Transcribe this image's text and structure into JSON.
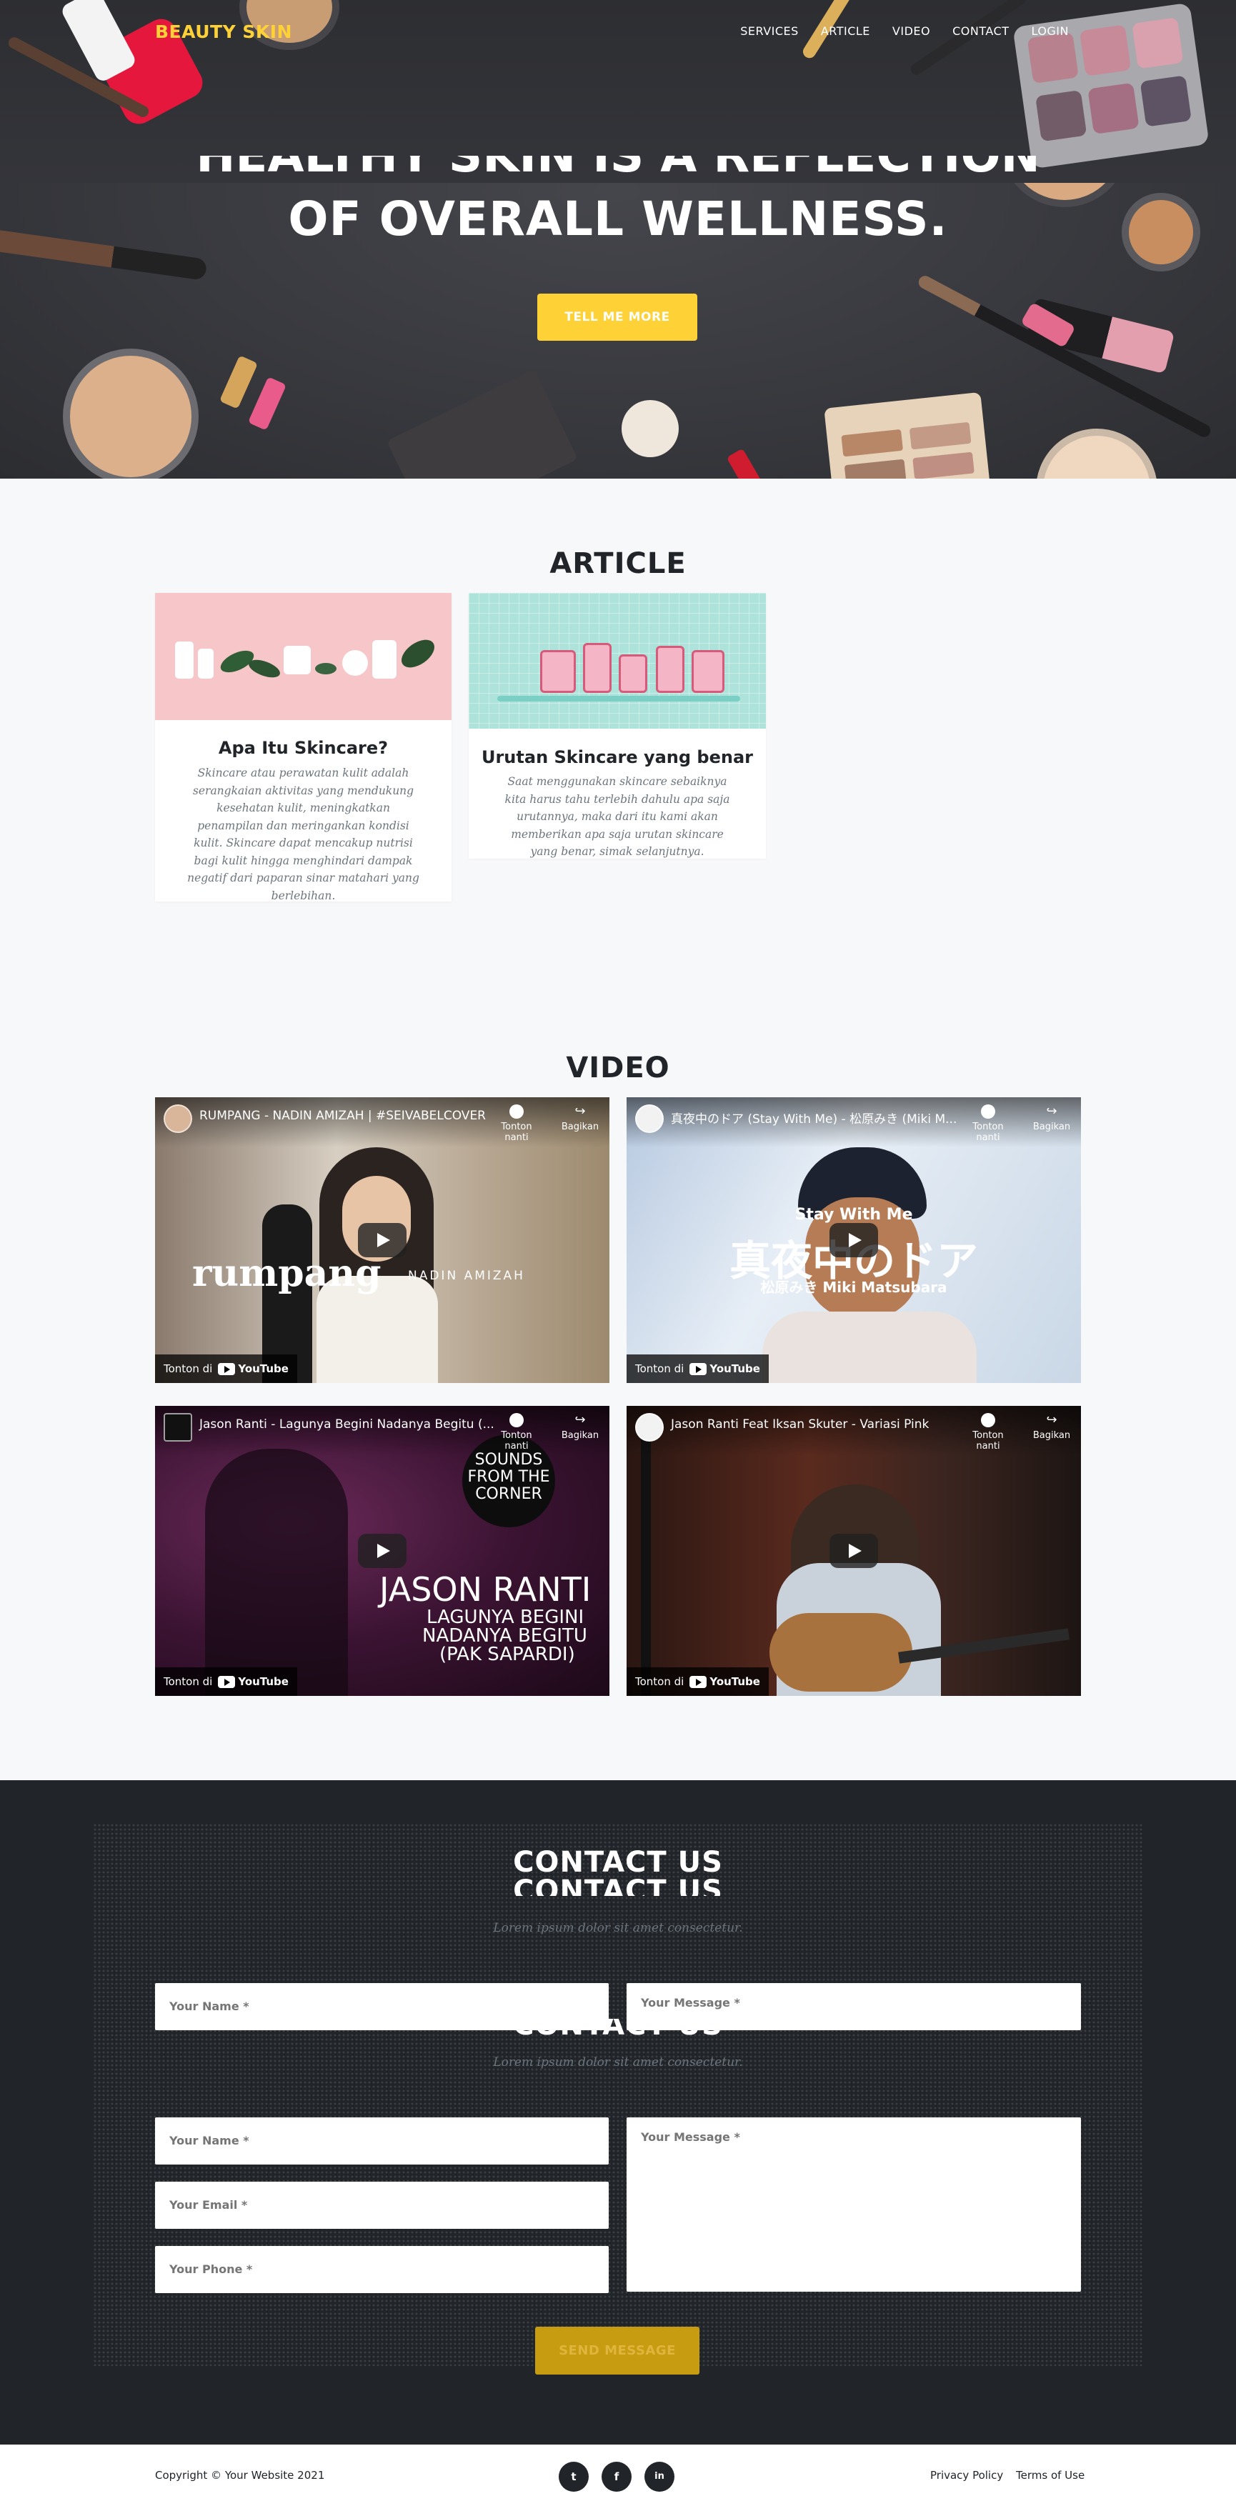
{
  "nav": {
    "brand": "BEAUTY SKIN",
    "links": [
      "SERVICES",
      "ARTICLE",
      "VIDEO",
      "CONTACT",
      "LOGIN"
    ]
  },
  "hero": {
    "heading_cut": "HEALTHY SKIN IS A REFLECTION",
    "heading": "OF OVERALL WELLNESS.",
    "button": "TELL ME MORE"
  },
  "article": {
    "title": "ARTICLE",
    "cards": [
      {
        "title": "Apa Itu Skincare?",
        "text": "Skincare atau perawatan kulit adalah serangkaian aktivitas yang mendukung kesehatan kulit, meningkatkan penampilan dan meringankan kondisi kulit. Skincare dapat mencakup nutrisi bagi kulit hingga menghindari dampak negatif dari paparan sinar matahari yang berlebihan."
      },
      {
        "title": "Urutan Skincare yang benar",
        "text": "Saat menggunakan skincare sebaiknya kita harus tahu terlebih dahulu apa saja urutannya, maka dari itu kami akan memberikan apa saja urutan skincare yang benar, simak selanjutnya."
      }
    ]
  },
  "video": {
    "title": "VIDEO",
    "watch_later": "Tonton nanti",
    "share": "Bagikan",
    "watch_on": "Tonton di",
    "youtube": "YouTube",
    "items": [
      {
        "title": "RUMPANG - NADIN AMIZAH | #SEIVABELCOVER",
        "overlay": "rumpang",
        "overlay2": "NADIN AMIZAH"
      },
      {
        "title": "真夜中のドア (Stay With Me) - 松原みき (Miki M...",
        "overlay": "真夜中のドア",
        "overlay2": "Stay With Me",
        "overlay3": "松原みき Miki Matsubara"
      },
      {
        "title": "Jason Ranti - Lagunya Begini Nadanya Begitu (...",
        "overlay": "JASON RANTI",
        "overlay2": "LAGUNYA BEGINI",
        "overlay3": "NADANYA BEGITU",
        "overlay4": "(PAK SAPARDI)",
        "badge": "SOUNDS FROM THE CORNER"
      },
      {
        "title": "Jason Ranti Feat Iksan Skuter - Variasi Pink"
      }
    ]
  },
  "contact": {
    "title": "CONTACT US",
    "subtitle": "Lorem ipsum dolor sit amet consectetur.",
    "name_placeholder": "Your Name *",
    "email_placeholder": "Your Email *",
    "phone_placeholder": "Your Phone *",
    "message_placeholder": "Your Message *",
    "send": "SEND MESSAGE"
  },
  "footer": {
    "copyright": "Copyright © Your Website 2021",
    "social": [
      "twitter-icon",
      "facebook-icon",
      "linkedin-icon"
    ],
    "social_glyphs": [
      "t",
      "f",
      "in"
    ],
    "privacy": "Privacy Policy",
    "terms": "Terms of Use"
  },
  "colors": {
    "accent": "#fed136",
    "dark": "#212529",
    "muted": "#6c757d"
  }
}
